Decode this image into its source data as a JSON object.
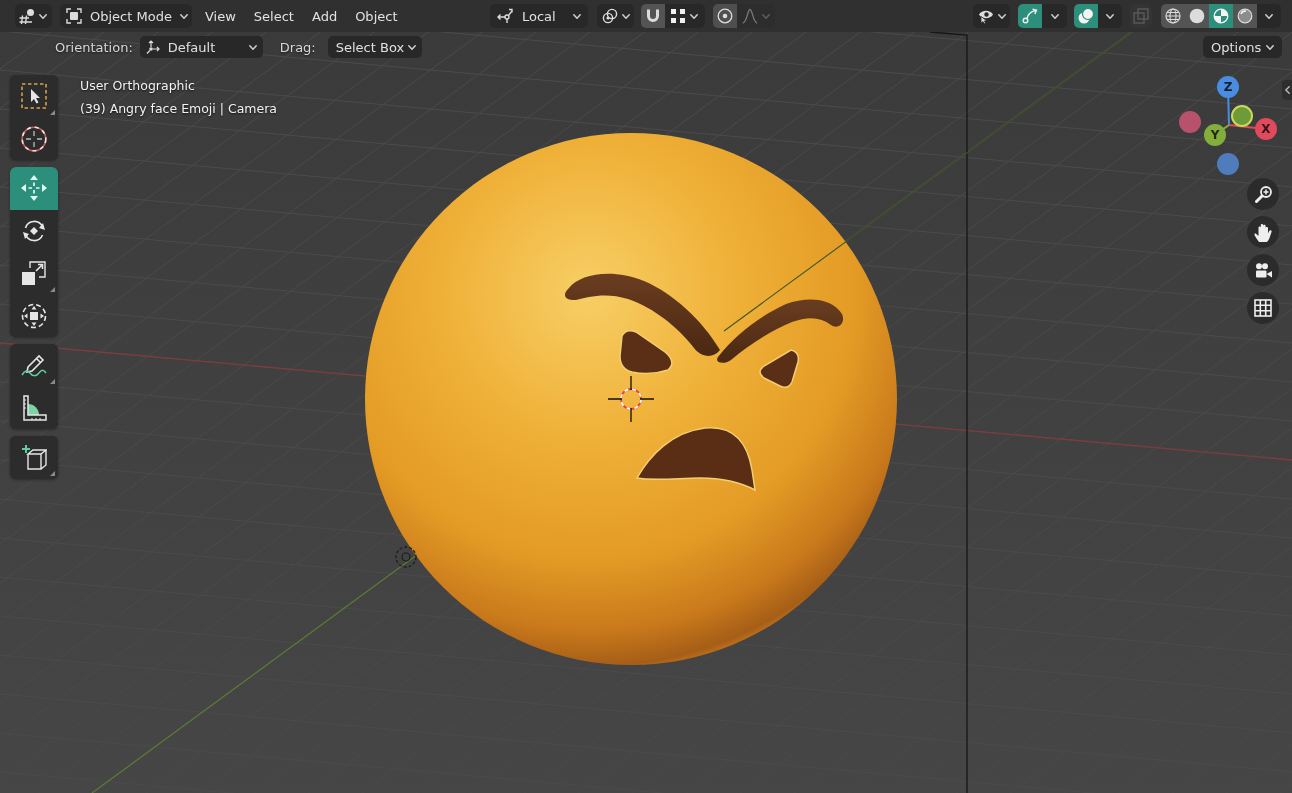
{
  "header": {
    "mode": {
      "label": "Object Mode"
    },
    "menus": [
      {
        "label": "View"
      },
      {
        "label": "Select"
      },
      {
        "label": "Add"
      },
      {
        "label": "Object"
      }
    ],
    "orientation": {
      "label": "Local"
    },
    "snapping": {
      "on": false
    },
    "proportional_editing": {
      "on": false
    },
    "falloff": {
      "disabled": true
    },
    "gizmos": {
      "on": true
    },
    "overlays": {
      "on": true
    },
    "xray": {
      "disabled": true
    },
    "shading_modes": [
      {
        "kind": "wireframe",
        "selected": false
      },
      {
        "kind": "solid",
        "selected": false
      },
      {
        "kind": "material",
        "selected": true
      },
      {
        "kind": "rendered",
        "selected": false
      }
    ]
  },
  "tool_settings": {
    "orientation": {
      "label": "Orientation:",
      "value": "Default"
    },
    "drag": {
      "label": "Drag:",
      "value": "Select Box"
    },
    "options": {
      "label": "Options"
    }
  },
  "viewport": {
    "view_name": "User Orthographic",
    "object_info": "(39) Angry face Emoji | Camera"
  },
  "toolbar": [
    {
      "tools": [
        {
          "kind": "select_box",
          "selected": false,
          "has_submenu": true
        },
        {
          "kind": "cursor",
          "selected": false,
          "has_submenu": false
        }
      ]
    },
    {
      "tools": [
        {
          "kind": "move",
          "selected": true,
          "has_submenu": false
        },
        {
          "kind": "rotate",
          "selected": false,
          "has_submenu": false
        },
        {
          "kind": "scale",
          "selected": false,
          "has_submenu": true
        },
        {
          "kind": "transform",
          "selected": false,
          "has_submenu": false
        }
      ]
    },
    {
      "tools": [
        {
          "kind": "annotate",
          "selected": false,
          "has_submenu": true
        },
        {
          "kind": "measure",
          "selected": false,
          "has_submenu": false
        }
      ]
    },
    {
      "tools": [
        {
          "kind": "add_cube",
          "selected": false,
          "has_submenu": true
        }
      ]
    }
  ],
  "nav_gizmo": {
    "axes": [
      {
        "kind": "positive",
        "label": "Z",
        "color": "#4a8ce0",
        "highlighted": false
      },
      {
        "kind": "positive",
        "label": "X",
        "color": "#e14a5c",
        "highlighted": false
      },
      {
        "kind": "positive",
        "label": "Y",
        "color": "#84ae3c",
        "highlighted": false
      },
      {
        "kind": "negative",
        "color": "#b8526a",
        "highlighted": false
      },
      {
        "kind": "negative",
        "color": "#6e9a38",
        "highlighted": true
      },
      {
        "kind": "negative",
        "color": "#4f7cbc",
        "highlighted": false
      }
    ]
  }
}
